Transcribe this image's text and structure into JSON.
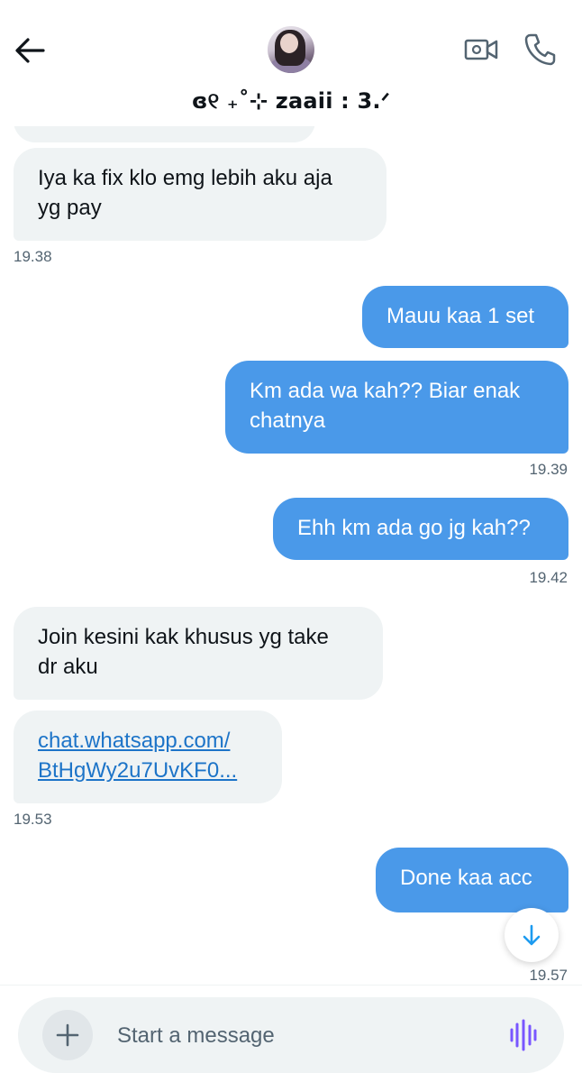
{
  "header": {
    "contact_name": "ɞ୧ ₊˚⊹ zaaii : 3.ᐟ",
    "back_icon": "arrow-left-icon",
    "video_icon": "video-camera-icon",
    "phone_icon": "phone-icon"
  },
  "messages": [
    {
      "side": "received",
      "text": "Iya ka fix klo emg lebih aku aja yg pay",
      "line1": "Iya ka fix klo emg lebih aku aja",
      "line2": "yg pay"
    },
    {
      "side": "sent",
      "text": "Mauu kaa 1 set"
    },
    {
      "side": "sent",
      "line1": "Km ada wa kah?? Biar enak",
      "line2": "chatnya"
    },
    {
      "side": "sent",
      "text": "Ehh km ada go jg kah??"
    },
    {
      "side": "received",
      "line1": "Join kesini kak khusus yg take",
      "line2": "dr aku"
    },
    {
      "side": "received",
      "link_line1": "chat.whatsapp.com/",
      "link_line2": "BtHgWy2u7UvKF0..."
    },
    {
      "side": "sent",
      "text": "Done kaa acc"
    }
  ],
  "timestamps": {
    "t1": "19.38",
    "t2": "19.39",
    "t3": "19.42",
    "t4": "19.53",
    "t5": "19.57"
  },
  "composer": {
    "placeholder": "Start a message",
    "plus_icon": "plus-icon",
    "voice_icon": "voice-wave-icon"
  },
  "colors": {
    "sent_bubble": "#4a99e9",
    "received_bubble": "#eff3f4",
    "link": "#1d74c8",
    "voice_accent": "#7856ff"
  }
}
